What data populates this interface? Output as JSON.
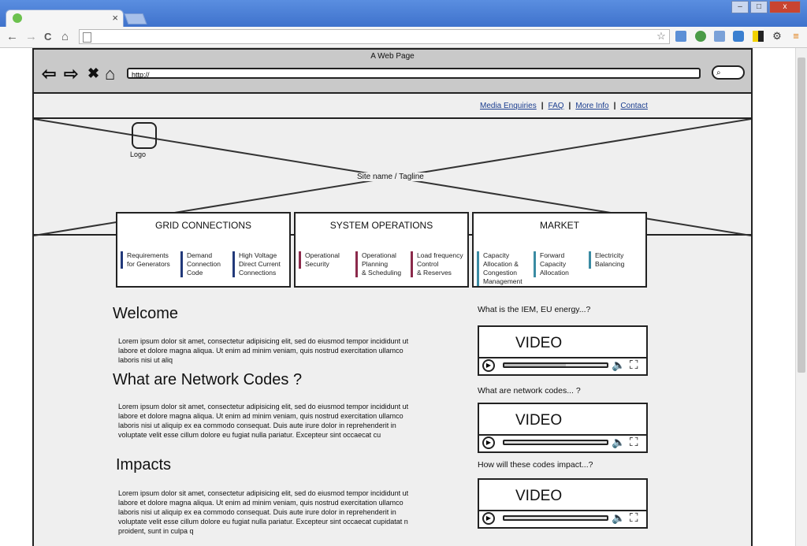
{
  "browser": {
    "tab_title": "",
    "tab_close": "×",
    "window_buttons": [
      "–",
      "□",
      "x"
    ],
    "nav_icons": {
      "back": "←",
      "forward": "→",
      "reload": "C",
      "home": "⌂"
    },
    "star_icon": "☆",
    "menu_icon": "≡"
  },
  "mockup": {
    "window_title": "A Web Page",
    "nav_icons": {
      "back": "⇦",
      "forward": "⇨",
      "stop": "✖",
      "home": "⌂"
    },
    "url": "http://",
    "search_icon": "⌕"
  },
  "top_links": [
    "Media Enquiries",
    "FAQ",
    "More Info",
    "Contact"
  ],
  "hero": {
    "logo_label": "Logo",
    "tagline": "Site name / Tagline"
  },
  "panels": [
    {
      "title": "GRID CONNECTIONS",
      "items": [
        {
          "label": "Requirements\nfor Generators",
          "color": "#22397a"
        },
        {
          "label": "Demand\nConnection\nCode",
          "color": "#22397a"
        },
        {
          "label": "High Voltage\nDirect Current\nConnections",
          "color": "#22397a"
        }
      ]
    },
    {
      "title": "SYSTEM OPERATIONS",
      "items": [
        {
          "label": "Operational\nSecurity",
          "color": "#8b2a4b"
        },
        {
          "label": "Operational\nPlanning\n& Scheduling",
          "color": "#8b2a4b"
        },
        {
          "label": "Load frequency\nControl\n& Reserves",
          "color": "#8b2a4b"
        }
      ]
    },
    {
      "title": "MARKET",
      "items": [
        {
          "label": "Capacity\nAllocation &\nCongestion\nManagement",
          "color": "#3a8ba3"
        },
        {
          "label": "Forward\nCapacity\nAllocation",
          "color": "#3a8ba3"
        },
        {
          "label": "Electricity\nBalancing",
          "color": "#3a8ba3"
        }
      ]
    }
  ],
  "sections": [
    {
      "heading": "Welcome",
      "lines": [
        "Lorem ipsum dolor sit amet, consectetur adipisicing elit, sed do eiusmod tempor incididunt ut",
        "labore et dolore magna aliqua. Ut enim ad minim veniam, quis nostrud exercitation ullamco",
        "laboris nisi ut aliq"
      ]
    },
    {
      "heading": "What are Network Codes ?",
      "lines": [
        "Lorem ipsum dolor sit amet, consectetur adipisicing elit, sed do eiusmod tempor incididunt ut",
        "labore et dolore magna aliqua. Ut enim ad minim veniam, quis nostrud exercitation ullamco",
        "laboris nisi ut aliquip ex ea commodo consequat. Duis aute irure dolor in reprehenderit in",
        "voluptate velit esse cillum dolore eu fugiat nulla pariatur. Excepteur sint occaecat cu"
      ]
    },
    {
      "heading": "Impacts",
      "lines": [
        "Lorem ipsum dolor sit amet, consectetur adipisicing elit, sed do eiusmod tempor incididunt ut",
        "labore et dolore magna aliqua. Ut enim ad minim veniam, quis nostrud exercitation ullamco",
        "laboris nisi ut aliquip ex ea commodo consequat. Duis aute irure dolor in reprehenderit in",
        "voluptate velit esse cillum dolore eu fugiat nulla pariatur. Excepteur sint occaecat cupidatat n",
        "proident, sunt in culpa q"
      ]
    }
  ],
  "videos": [
    {
      "question": "What is the IEM, EU energy...?",
      "label": "VIDEO",
      "progress": 0.6
    },
    {
      "question": "What are network codes... ?",
      "label": "VIDEO",
      "progress": 0.0
    },
    {
      "question": "How will these codes impact...?",
      "label": "VIDEO",
      "progress": 0.0
    }
  ]
}
